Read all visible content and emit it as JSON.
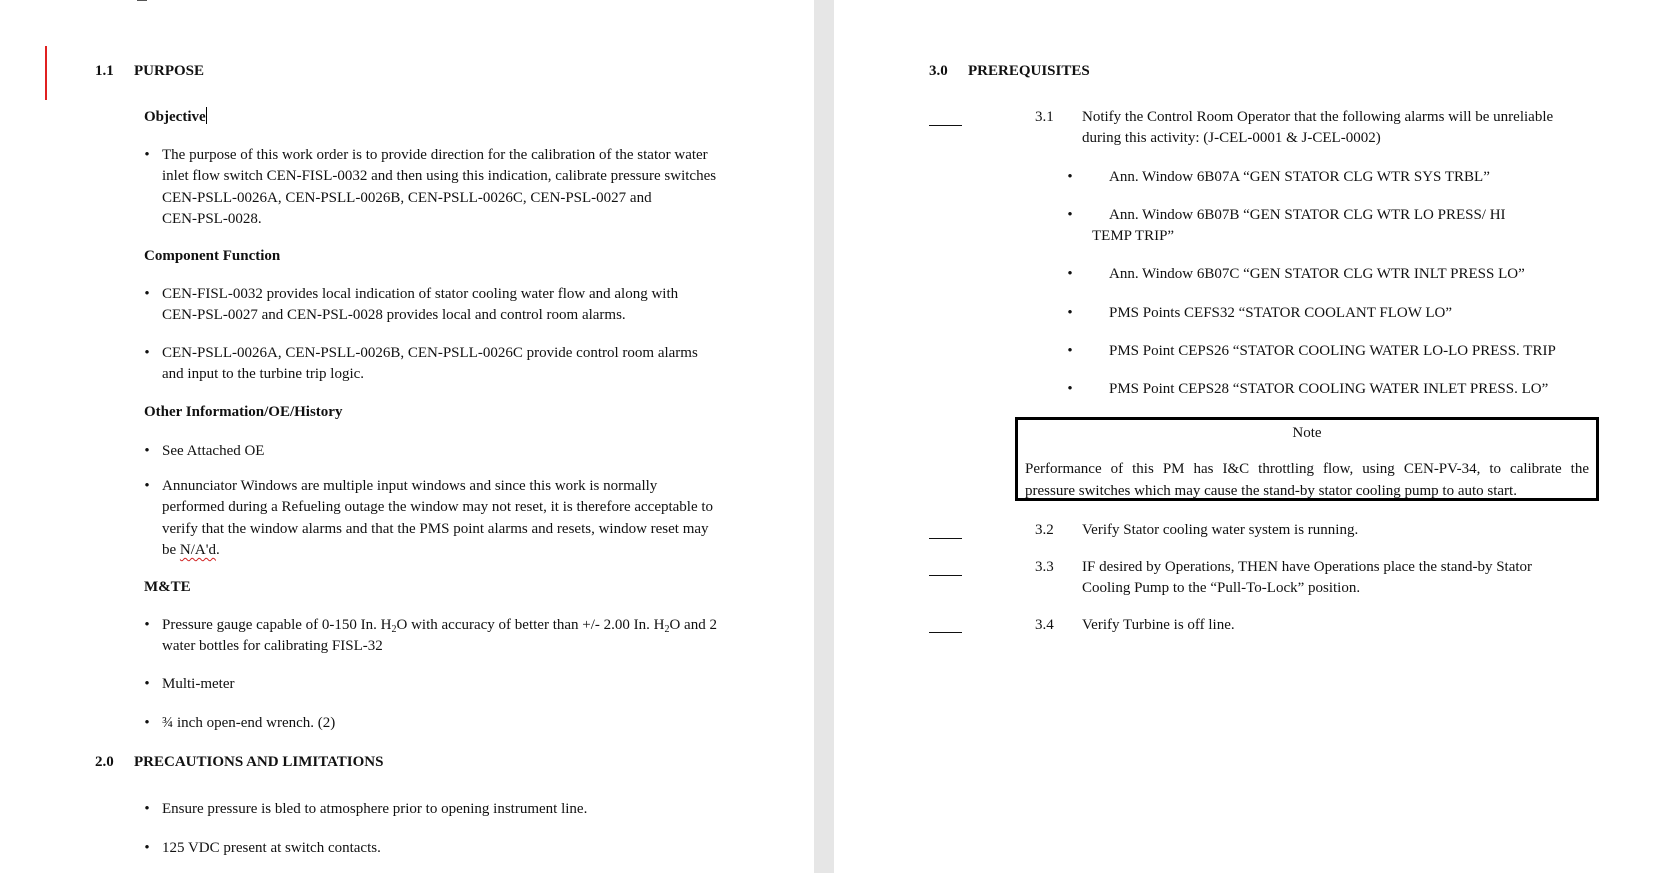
{
  "left": {
    "sec11_num": "1.1",
    "sec11_title": "PURPOSE",
    "objective": "Objective",
    "obj_b1_lines": [
      "The purpose of this work order is to provide direction for the calibration of the stator water",
      "inlet flow switch CEN-FISL-0032 and then using this indication, calibrate pressure switches",
      "CEN-PSLL-0026A, CEN-PSLL-0026B, CEN-PSLL-0026C, CEN-PSL-0027 and",
      "CEN-PSL-0028."
    ],
    "component_function": "Component Function",
    "cf_b1_lines": [
      "CEN-FISL-0032 provides local indication of stator cooling water flow and along with",
      "CEN-PSL-0027 and CEN-PSL-0028 provides local and control room alarms."
    ],
    "cf_b2_lines": [
      "CEN-PSLL-0026A, CEN-PSLL-0026B, CEN-PSLL-0026C provide control room alarms",
      "and input to the turbine trip logic."
    ],
    "other_info": "Other Information/OE/History",
    "oi_b1": "See Attached OE",
    "oi_b2_lines": [
      "Annunciator Windows are multiple input windows and since this work is normally",
      "performed during a Refueling outage the window may not reset, it is therefore acceptable to",
      "verify that the window alarms and that the PMS point alarms and resets, window reset may"
    ],
    "oi_b2_last_prefix": "be ",
    "oi_b2_last_word": "N/A'd",
    "oi_b2_last_suffix": ".",
    "mte": "M&TE",
    "mte_b1_line1_a": "Pressure gauge capable of 0-150 In. H",
    "mte_b1_line1_sub1": "2",
    "mte_b1_line1_b": "O with accuracy of better than +/- 2.00 In. H",
    "mte_b1_line1_sub2": "2",
    "mte_b1_line1_c": "O and 2",
    "mte_b1_line2": "water bottles for calibrating FISL-32",
    "mte_b2": "Multi-meter",
    "mte_b3": "¾ inch open-end wrench. (2)",
    "sec20_num": "2.0",
    "sec20_title": "PRECAUTIONS AND LIMITATIONS",
    "pl_b1": "Ensure pressure is bled to atmosphere prior to opening instrument line.",
    "pl_b2": "125 VDC present at switch contacts."
  },
  "right": {
    "sec30_num": "3.0",
    "sec30_title": "PREREQUISITES",
    "s31_num": "3.1",
    "s31_lines": [
      "Notify the Control Room Operator that the following alarms will be unreliable",
      "during this activity: (J-CEL-0001 & J-CEL-0002)"
    ],
    "alarm_b1": "Ann. Window 6B07A “GEN STATOR CLG WTR SYS TRBL”",
    "alarm_b2_line1": "Ann. Window 6B07B “GEN STATOR CLG WTR LO PRESS/ HI",
    "alarm_b2_line2": "TEMP TRIP”",
    "alarm_b3": "Ann. Window 6B07C “GEN STATOR CLG WTR INLT PRESS LO”",
    "alarm_b4": "PMS Points CEFS32 “STATOR COOLANT FLOW LO”",
    "alarm_b5": "PMS Point CEPS26 “STATOR COOLING WATER LO-LO PRESS. TRIP",
    "alarm_b6": "PMS Point CEPS28 “STATOR COOLING WATER INLET PRESS. LO”",
    "note_title": "Note",
    "note_lines": [
      "Performance of this PM has I&C throttling flow, using CEN-PV-34, to calibrate the",
      "pressure switches which may cause the stand-by stator cooling pump to auto start."
    ],
    "s32_num": "3.2",
    "s32_text": "Verify Stator cooling water system is running.",
    "s33_num": "3.3",
    "s33_lines": [
      "IF desired by Operations, THEN have Operations place the stand-by Stator",
      "Cooling Pump to the “Pull-To-Lock” position."
    ],
    "s34_num": "3.4",
    "s34_text": "Verify Turbine is off line."
  }
}
